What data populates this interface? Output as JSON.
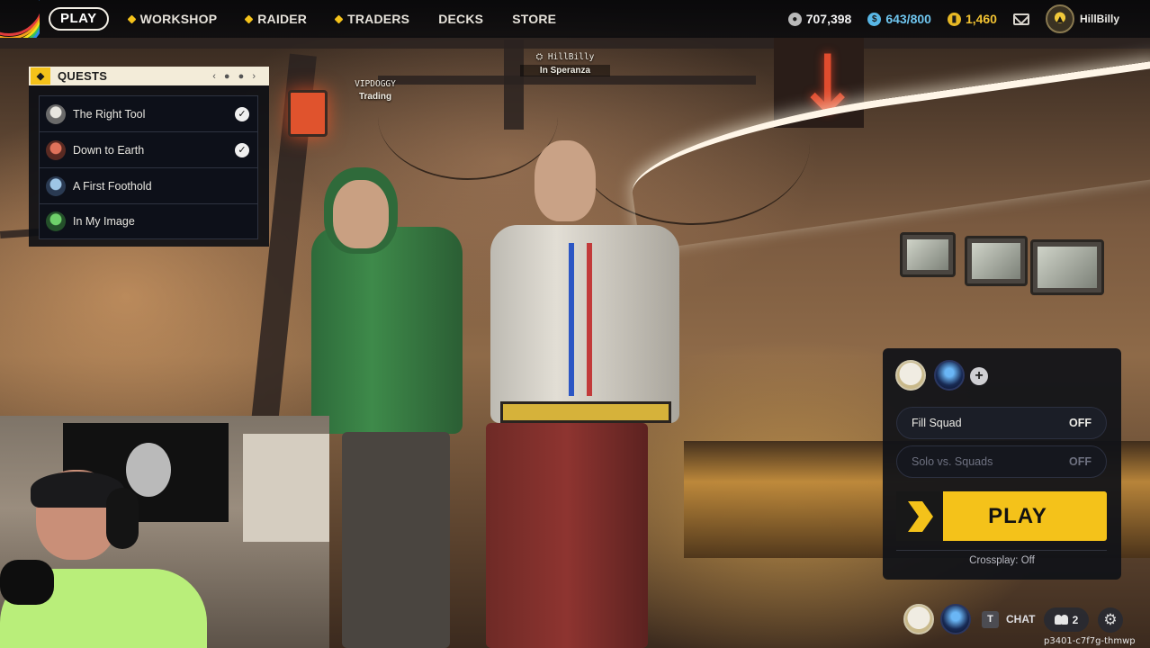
{
  "nav": {
    "play": "PLAY",
    "items": [
      {
        "label": "WORKSHOP",
        "dot": true
      },
      {
        "label": "RAIDER",
        "dot": true
      },
      {
        "label": "TRADERS",
        "dot": true
      },
      {
        "label": "DECKS",
        "dot": false
      },
      {
        "label": "STORE",
        "dot": false
      }
    ]
  },
  "currency": {
    "coins": "707,398",
    "energy": "643/800",
    "gold": "1,460"
  },
  "user": {
    "name": "HillBilly"
  },
  "quests": {
    "title": "QUESTS",
    "pager": "‹ ● ● ›",
    "items": [
      {
        "name": "The Right Tool",
        "completed": true
      },
      {
        "name": "Down to Earth",
        "completed": true
      },
      {
        "name": "A First Foothold",
        "completed": false
      },
      {
        "name": "In My Image",
        "completed": false
      }
    ]
  },
  "nameplates": {
    "player1": {
      "name": "HillBilly",
      "status": "In Speranza"
    },
    "player2": {
      "name": "VIPDOGGY",
      "status": "Trading"
    }
  },
  "squad": {
    "add": "+",
    "fill_squad": {
      "label": "Fill Squad",
      "value": "OFF"
    },
    "solo_vs_squads": {
      "label": "Solo vs. Squads",
      "value": "OFF"
    },
    "play_label": "PLAY",
    "crossplay": "Crossplay: Off"
  },
  "bottom": {
    "chat_key": "T",
    "chat_label": "CHAT",
    "friends_count": "2",
    "version": "p3401-c7f7g-thmwp"
  },
  "colors": {
    "accent": "#f4c21a",
    "energy": "#6fc6ef",
    "gold": "#f1c232"
  }
}
